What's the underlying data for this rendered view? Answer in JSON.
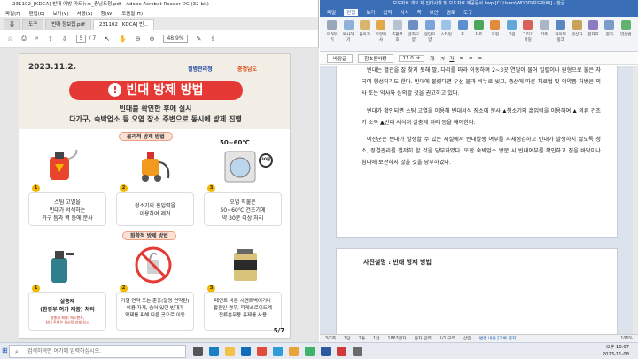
{
  "acrobat": {
    "title": "231102_[KDCA] 빈대 예방 카드뉴스_충남도청.pdf - Adobe Acrobat Reader DC (32-bit)",
    "menu": [
      "파일(F)",
      "편집(E)",
      "보기(V)",
      "서명(S)",
      "창(W)",
      "도움말(H)"
    ],
    "tabs": [
      "홈",
      "도구",
      "빈대 정보집.pdf",
      "231102_[KDCA] 빈..."
    ],
    "page_current": "5",
    "page_total": "/ 7",
    "zoom": "48.9%"
  },
  "poster": {
    "date": "2023.11.2.",
    "org1": "질병관리청",
    "org2": "충청남도",
    "title": "빈대 방제 방법",
    "sub1": "빈대를 확인한 후에 실시",
    "sub2": "다가구, 숙박업소 등 오염 장소 주변으로 동시에 방제 진행",
    "physical_label": "물리적 방제 방법",
    "physical": [
      "스팀 고열을\n빈대가 서식하는\n가구 틈과 벽 틈에 분사",
      "청소기의 흡입력을\n이용하여 제거",
      "오염 직물은\n50~60℃ 건조기에\n약 30분 이상 처리"
    ],
    "temp": "50~60℃",
    "minutes": "30분",
    "chemical_label": "화학적 방제 방법",
    "chemical": [
      "살충제\n(환경부 허가 제품) 처리",
      "가열 연막 또는 훈증(일명 연막탄)\n이용 자제, 숨어 있던 빈대가\n약제를 피해 다른 곳으로 이동",
      "페인트 바른 시멘트벽이거나\n합판인 경우, 피레스로이드계\n잔류분무용 유제를 사용"
    ],
    "chem_note": "살충제 제제: 에토펜프,\n침대 주변은 물리적 방제 실시",
    "page": "5/7"
  },
  "word": {
    "title": "보도자료 개요 자 인대사항 및 보도자료 재공문서.hwp [C:\\Users\\WDDD\\보도자료\\] - 한글",
    "menu": [
      "파일",
      "편집",
      "보기",
      "입력",
      "서식",
      "쪽",
      "보안",
      "검토",
      "도구"
    ],
    "ribbon": [
      "오려두기",
      "복사하기",
      "붙이기",
      "모양복사",
      "조판부호",
      "글자모양",
      "문단모양",
      "스타일",
      "표",
      "차트",
      "도형",
      "그림",
      "그리기마당",
      "각주",
      "하이퍼링크",
      "글상자",
      "문자표",
      "한자",
      "맞춤법",
      "쪽번호",
      "머리말",
      "새 쪽"
    ],
    "p1": "빈대는 혈관을 잘 찾지 못해 팔, 다리를 따라 이동하며 2~3곳 연달아 물어 일렬이나 원형으로 붉은 자국이 형성되기도 한다. 빈대에 물렸다면 우선 물과 비누로 씻고, 증상에 따른 치료법 및 의약품 처방은 의사 또는 약사와 상의할 것을 권고하고 있다.",
    "p2": "빈대가 확인되면 스팀 고열을 이용해 빈대서식 장소에 분사 ▲청소기의 흡입력을 이용하여 ▲ 의류 건조기 소독 ▲빈대 서식처 살충제 처리 등을 해야한다.",
    "p3": "예산군은 빈대가 발생할 수 있는 시설에서 빈대발생 여부를 자체점검하고 빈대가 발생하지 않도록 청소, 정결관리를 철저히 할 것을 당부하였다. 또한 숙박업소 방문 시 빈대여부를 확인하고 짐을 바닥이나 침대에 보관하지 않을 것을 당부하였다.",
    "photo_caption": "사진설명 : 빈대 방제 방법",
    "status": [
      "3/3쪽",
      "1단",
      "2줄",
      "1칸",
      "1863글자",
      "문자 입력",
      "1/1 구역",
      "삽입",
      "변경 내용 [기록 중지]"
    ],
    "zoom": "106%"
  },
  "taskbar": {
    "search": "검색하려면 여기에 입력하십시오.",
    "time": "오후 10:07",
    "date": "2023-11-08"
  }
}
